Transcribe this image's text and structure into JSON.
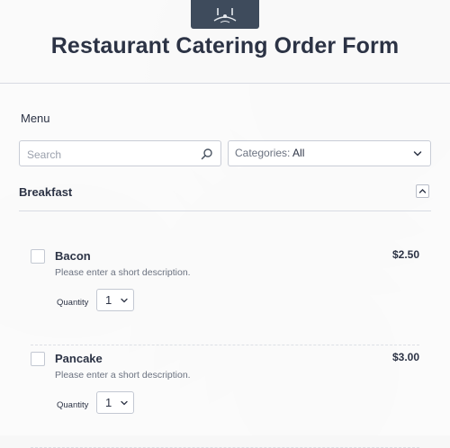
{
  "header": {
    "title": "Restaurant Catering Order Form",
    "logo_icon": "restaurant-logo-icon"
  },
  "menu": {
    "label": "Menu",
    "search": {
      "placeholder": "Search",
      "value": "",
      "icon": "search-icon"
    },
    "categories": {
      "prefix": "Categories:",
      "value": "All",
      "icon": "chevron-down-icon"
    }
  },
  "sections": [
    {
      "title": "Breakfast",
      "collapse_icon": "chevron-up-icon",
      "items": [
        {
          "name": "Bacon",
          "price": "$2.50",
          "description": "Please enter a short description.",
          "quantity_label": "Quantity",
          "quantity": "1",
          "checked": false
        },
        {
          "name": "Pancake",
          "price": "$3.00",
          "description": "Please enter a short description.",
          "quantity_label": "Quantity",
          "quantity": "1",
          "checked": false
        }
      ]
    }
  ],
  "colors": {
    "text": "#2c3345",
    "muted": "#6b7280",
    "logo_bg": "#3e4b5c",
    "border": "#c8ccd6"
  }
}
